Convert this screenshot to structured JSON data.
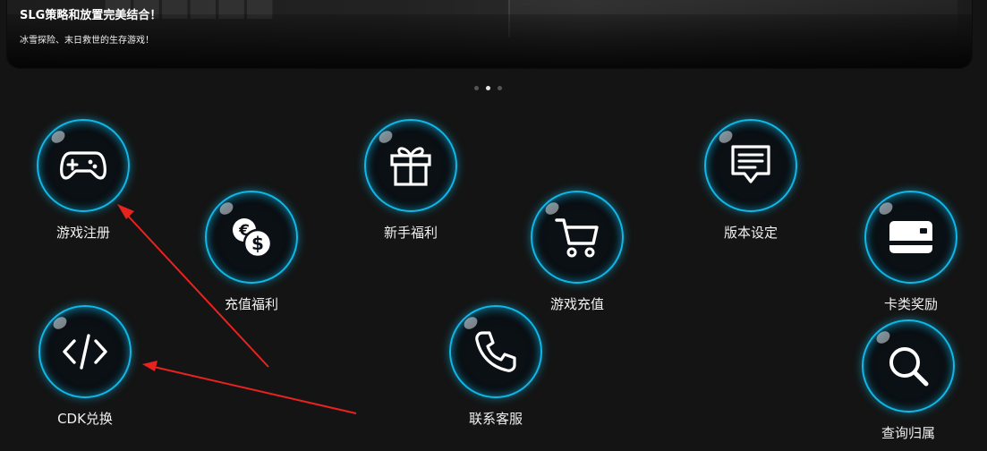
{
  "banner": {
    "title": "SLG策略和放置完美结合！",
    "subtitle": "冰雪探险、末日救世的生存游戏！",
    "carousel_dots": 3,
    "active_dot": 1
  },
  "menu": {
    "game_register": "游戏注册",
    "recharge_bonus": "充值福利",
    "newbie_bonus": "新手福利",
    "game_recharge": "游戏充值",
    "version_settings": "版本设定",
    "card_rewards": "卡类奖励",
    "cdk_redeem": "CDK兑换",
    "contact_support": "联系客服",
    "query_attribution": "查询归属"
  },
  "icons": {
    "game_register": "gamepad-icon",
    "recharge_bonus": "coins-icon",
    "newbie_bonus": "gift-icon",
    "game_recharge": "shopping-cart-icon",
    "version_settings": "message-icon",
    "card_rewards": "card-icon",
    "cdk_redeem": "code-icon",
    "contact_support": "phone-icon",
    "query_attribution": "search-icon"
  },
  "colors": {
    "background": "#141414",
    "ring": "#0fb8e8",
    "arrow": "#e8231f"
  }
}
